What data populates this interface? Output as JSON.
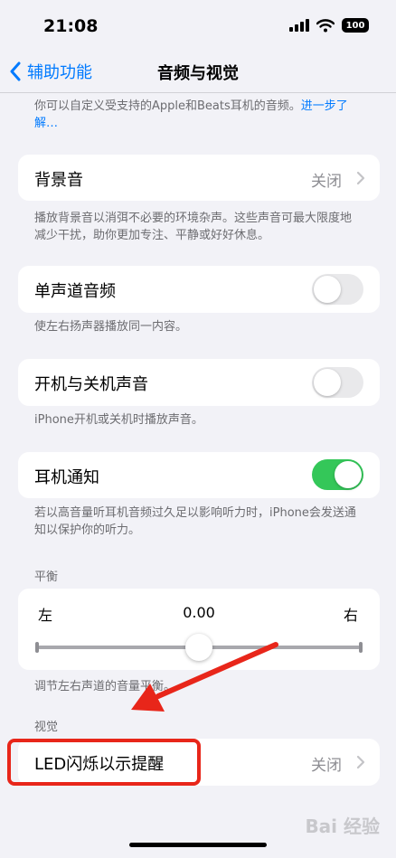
{
  "status": {
    "time": "21:08",
    "battery": "100"
  },
  "nav": {
    "back_label": "辅助功能",
    "title": "音频与视觉"
  },
  "intro": {
    "text": "你可以自定义受支持的Apple和Beats耳机的音频。",
    "link": "进一步了解…"
  },
  "background_sounds": {
    "label": "背景音",
    "value": "关闭",
    "footer": "播放背景音以消弭不必要的环境杂声。这些声音可最大限度地减少干扰，助你更加专注、平静或好好休息。"
  },
  "mono_audio": {
    "label": "单声道音频",
    "state": false,
    "footer": "使左右扬声器播放同一内容。"
  },
  "power_sounds": {
    "label": "开机与关机声音",
    "state": false,
    "footer": "iPhone开机或关机时播放声音。"
  },
  "headphone_notifications": {
    "label": "耳机通知",
    "state": true,
    "footer": "若以高音量听耳机音频过久足以影响听力时，iPhone会发送通知以保护你的听力。"
  },
  "balance": {
    "header": "平衡",
    "left": "左",
    "right": "右",
    "value": "0.00",
    "position": 0.5,
    "footer": "调节左右声道的音量平衡。"
  },
  "visual": {
    "header": "视觉",
    "led_label": "LED闪烁以示提醒",
    "led_value": "关闭"
  },
  "watermark": "Bai 经验",
  "colors": {
    "accent": "#007aff",
    "toggle_on": "#34c759",
    "annotation": "#e8261a"
  }
}
